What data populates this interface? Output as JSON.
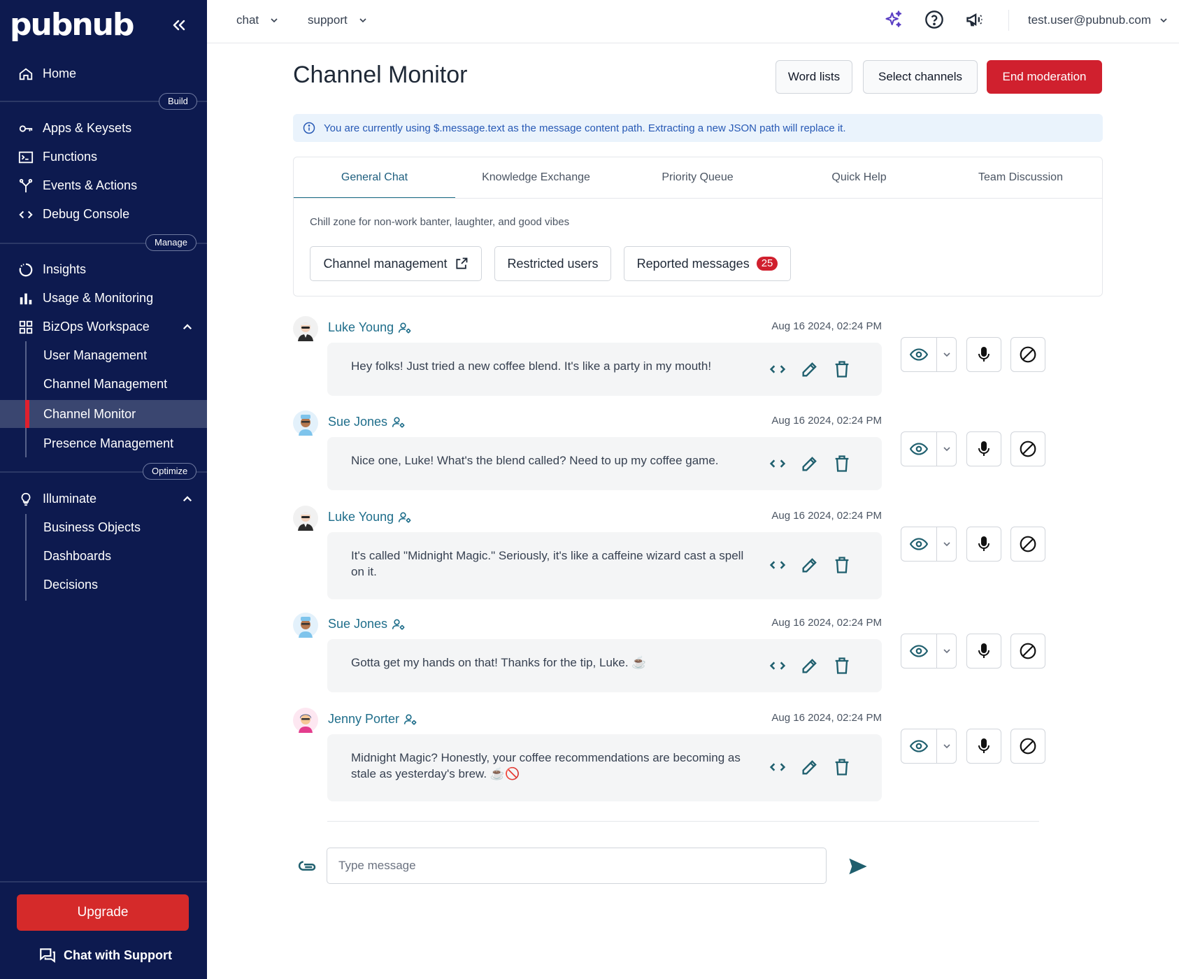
{
  "colors": {
    "sidebar": "#0d1a4f",
    "accent_red": "#d0202e",
    "teal": "#1f6e8b",
    "info_bg": "#eaf3fc",
    "info_text": "#2759b5"
  },
  "sidebar": {
    "logo": "pubnub",
    "home": "Home",
    "sections": {
      "build": "Build",
      "manage": "Manage",
      "optimize": "Optimize"
    },
    "build_items": [
      "Apps & Keysets",
      "Functions",
      "Events & Actions",
      "Debug Console"
    ],
    "manage_items": [
      "Insights",
      "Usage & Monitoring",
      "BizOps Workspace"
    ],
    "bizops_items": [
      "User Management",
      "Channel Management",
      "Channel Monitor",
      "Presence Management"
    ],
    "optimize_items": [
      "Illuminate"
    ],
    "illuminate_items": [
      "Business Objects",
      "Dashboards",
      "Decisions"
    ],
    "upgrade": "Upgrade",
    "support": "Chat with Support"
  },
  "topbar": {
    "app": "chat",
    "keyset": "support",
    "user": "test.user@pubnub.com"
  },
  "page": {
    "title": "Channel Monitor",
    "buttons": {
      "word_lists": "Word lists",
      "select_channels": "Select channels",
      "end_moderation": "End moderation"
    },
    "info": "You are currently using $.message.text as the message content path. Extracting a new JSON path will replace it.",
    "tabs": [
      "General Chat",
      "Knowledge Exchange",
      "Priority Queue",
      "Quick Help",
      "Team Discussion"
    ],
    "active_tab": "General Chat",
    "channel_description": "Chill zone for non-work banter, laughter, and good vibes",
    "channel_buttons": {
      "channel_management": "Channel management",
      "restricted_users": "Restricted users",
      "reported_messages": "Reported messages",
      "reported_count": "25"
    }
  },
  "messages": [
    {
      "user": "Luke Young",
      "time": "Aug 16 2024, 02:24 PM",
      "text": "Hey folks! Just tried a new coffee blend. It's like a party in my mouth!"
    },
    {
      "user": "Sue Jones",
      "time": "Aug 16 2024, 02:24 PM",
      "text": "Nice one, Luke! What's the blend called? Need to up my coffee game."
    },
    {
      "user": "Luke Young",
      "time": "Aug 16 2024, 02:24 PM",
      "text": "It's called \"Midnight Magic.\" Seriously, it's like a caffeine wizard cast a spell on it."
    },
    {
      "user": "Sue Jones",
      "time": "Aug 16 2024, 02:24 PM",
      "text": "Gotta get my hands on that! Thanks for the tip, Luke. ☕"
    },
    {
      "user": "Jenny Porter",
      "time": "Aug 16 2024, 02:24 PM",
      "text": "Midnight Magic? Honestly, your coffee recommendations are becoming as stale as yesterday's brew. ☕🚫"
    }
  ],
  "composer": {
    "placeholder": "Type message"
  }
}
